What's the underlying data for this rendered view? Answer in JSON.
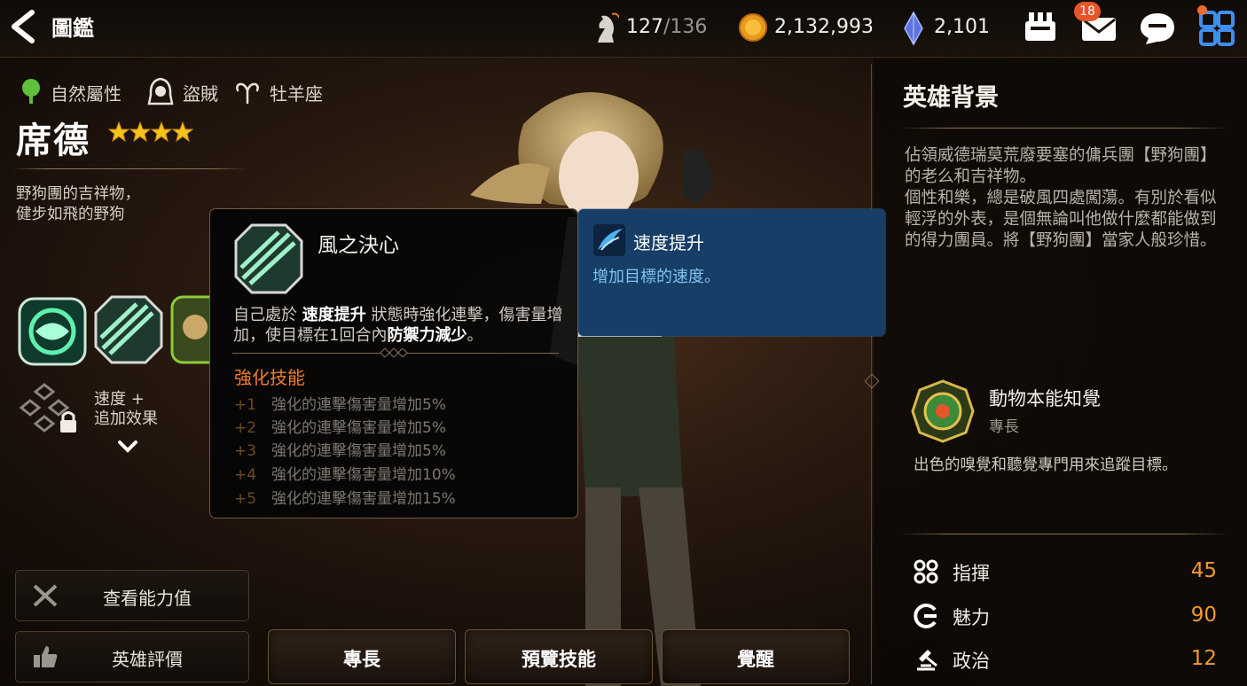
{
  "header": {
    "title": "圖鑑",
    "stamina": {
      "current": "127",
      "max": "/136"
    },
    "gold": "2,132,993",
    "crystal": "2,101",
    "mail_badge": "18"
  },
  "hero": {
    "attribute": "自然屬性",
    "class": "盜賊",
    "zodiac": "牡羊座",
    "name": "席德",
    "stars": 4,
    "tagline_1": "野狗團的吉祥物，",
    "tagline_2": "健步如飛的野狗"
  },
  "awaken": {
    "line1": "速度 +",
    "line2": "追加效果"
  },
  "left_buttons": {
    "stats": "查看能力值",
    "review": "英雄評價"
  },
  "bottom_tabs": {
    "specialty": "專長",
    "preview_skills": "預覽技能",
    "awaken": "覺醒"
  },
  "tooltip": {
    "name": "風之決心",
    "desc_pre": "自己處於 ",
    "desc_b1": "速度提升",
    "desc_mid": " 狀態時強化連擊，傷害量增加，使目標在1回合內",
    "desc_b2": "防禦力減少",
    "desc_post": "。",
    "enhance_title": "強化技能",
    "enhancements": [
      {
        "level": "+1",
        "text": "強化的連擊傷害量增加5%"
      },
      {
        "level": "+2",
        "text": "強化的連擊傷害量增加5%"
      },
      {
        "level": "+3",
        "text": "強化的連擊傷害量增加5%"
      },
      {
        "level": "+4",
        "text": "強化的連擊傷害量增加10%"
      },
      {
        "level": "+5",
        "text": "強化的連擊傷害量增加15%"
      }
    ]
  },
  "buff": {
    "name": "速度提升",
    "desc": "增加目標的速度。"
  },
  "background": {
    "title": "英雄背景",
    "story": "佔領威德瑞莫荒廢要塞的傭兵團【野狗團】的老么和吉祥物。\n個性和樂，總是破風四處闖蕩。有別於看似輕浮的外表，是個無論叫他做什麼都能做到的得力團員。將【野狗團】當家人般珍惜。"
  },
  "perk": {
    "name": "動物本能知覺",
    "type": "專長",
    "desc": "出色的嗅覺和聽覺專門用來追蹤目標。"
  },
  "stats": [
    {
      "label": "指揮",
      "value": "45",
      "icon": "command-icon"
    },
    {
      "label": "魅力",
      "value": "90",
      "icon": "charm-icon"
    },
    {
      "label": "政治",
      "value": "12",
      "icon": "politics-icon"
    }
  ],
  "colors": {
    "accent_orange": "#f29a2e",
    "buff_blue": "#163e66",
    "buff_text": "#7fc3f2"
  }
}
